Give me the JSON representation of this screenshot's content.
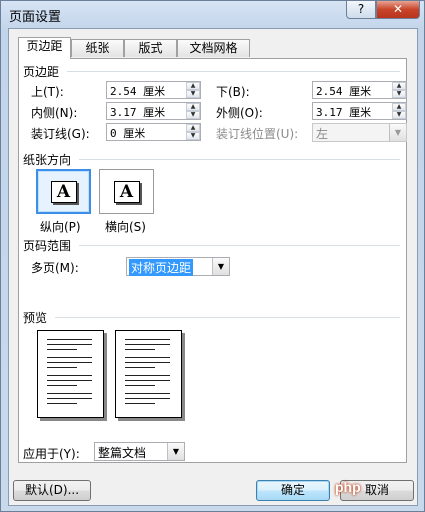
{
  "window": {
    "title": "页面设置",
    "help_label": "?",
    "close_label": "✕"
  },
  "tabs": [
    {
      "label": "页边距",
      "active": true
    },
    {
      "label": "纸张",
      "active": false
    },
    {
      "label": "版式",
      "active": false
    },
    {
      "label": "文档网格",
      "active": false
    }
  ],
  "margins": {
    "group_label": "页边距",
    "top": {
      "label": "上(T):",
      "value": "2.54 厘米"
    },
    "bottom": {
      "label": "下(B):",
      "value": "2.54 厘米"
    },
    "inside": {
      "label": "内侧(N):",
      "value": "3.17 厘米"
    },
    "outside": {
      "label": "外侧(O):",
      "value": "3.17 厘米"
    },
    "gutter": {
      "label": "装订线(G):",
      "value": "0 厘米"
    },
    "gutter_position": {
      "label": "装订线位置(U):",
      "value": "左"
    }
  },
  "orientation": {
    "group_label": "纸张方向",
    "glyph": "A",
    "portrait_label": "纵向(P)",
    "landscape_label": "横向(S)",
    "selected": "portrait"
  },
  "pages": {
    "group_label": "页码范围",
    "multiple_label": "多页(M):",
    "multiple_value": "对称页边距"
  },
  "preview": {
    "group_label": "预览"
  },
  "apply": {
    "label": "应用于(Y):",
    "value": "整篇文档"
  },
  "buttons": {
    "default_label": "默认(D)...",
    "ok_label": "确定",
    "cancel_label": "取消"
  },
  "watermark": "php",
  "colors": {
    "selection": "#3d8ee6",
    "close": "#c8442a"
  }
}
